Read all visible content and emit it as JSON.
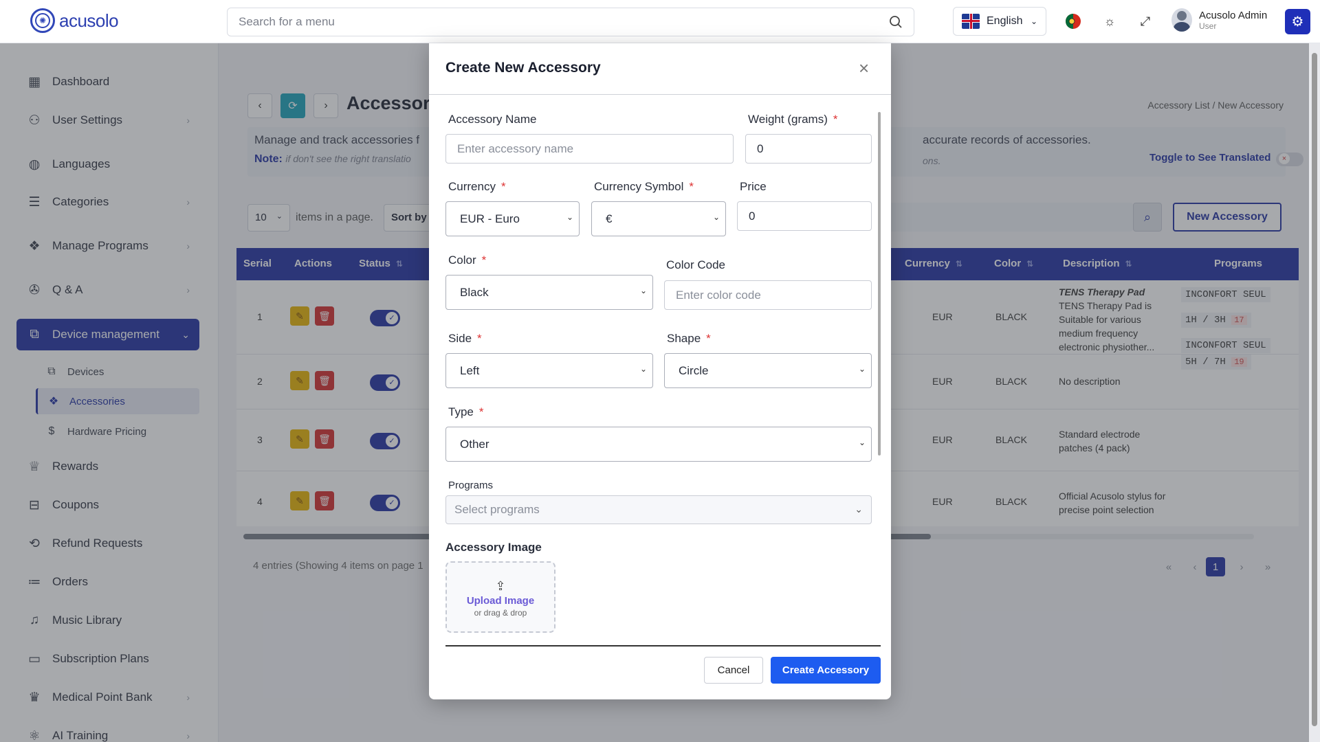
{
  "app": {
    "logo_text": "acusolo",
    "search_placeholder": "Search for a menu",
    "language": "English",
    "user_name": "Acusolo Admin",
    "user_role": "User"
  },
  "sidebar": {
    "items": [
      {
        "label": "Dashboard",
        "icon": "grid-icon"
      },
      {
        "label": "User Settings",
        "icon": "user-gear-icon"
      },
      {
        "label": "Languages",
        "icon": "globe-icon"
      },
      {
        "label": "Categories",
        "icon": "list-icon"
      },
      {
        "label": "Manage Programs",
        "icon": "programs-icon"
      },
      {
        "label": "Q & A",
        "icon": "help-icon"
      },
      {
        "label": "Device management",
        "icon": "devices-icon"
      },
      {
        "label": "Rewards",
        "icon": "trophy-icon"
      },
      {
        "label": "Coupons",
        "icon": "ticket-icon"
      },
      {
        "label": "Refund Requests",
        "icon": "refund-icon"
      },
      {
        "label": "Orders",
        "icon": "orders-icon"
      },
      {
        "label": "Music Library",
        "icon": "music-icon"
      },
      {
        "label": "Subscription Plans",
        "icon": "card-icon"
      },
      {
        "label": "Medical Point Bank",
        "icon": "medal-icon"
      },
      {
        "label": "AI Training",
        "icon": "ai-icon"
      }
    ],
    "sub_items": [
      {
        "label": "Devices"
      },
      {
        "label": "Accessories"
      },
      {
        "label": "Hardware Pricing"
      }
    ]
  },
  "page": {
    "title": "Accessory",
    "breadcrumb": "Accessory List  /  New Accessory",
    "info_line1_left": "Manage and track accessories f",
    "info_line1_right": "accurate records of accessories.",
    "note_label": "Note:",
    "note_text": "if don't see the right translatio",
    "note_text_right": "ons.",
    "toggle_translate": "Toggle to See Translated",
    "per_page": "10",
    "per_page_label": "items in a page.",
    "sort_by": "Sort by",
    "new_button": "New Accessory",
    "entries_text": "4 entries (Showing 4 items on page 1",
    "current_page": "1"
  },
  "table": {
    "headers": {
      "serial": "Serial",
      "actions": "Actions",
      "status": "Status",
      "currency": "Currency",
      "color": "Color",
      "description": "Description",
      "programs": "Programs"
    },
    "rows": [
      {
        "serial": "1",
        "currency": "EUR",
        "color": "BLACK",
        "desc_title": "TENS Therapy Pad",
        "desc": "TENS Therapy Pad is Suitable for various medium frequency electronic physiother...",
        "programs": [
          "INCONFORT SEUL",
          "1H / 3H",
          "INCONFORT SEUL"
        ],
        "prog_num": "17"
      },
      {
        "serial": "2",
        "currency": "EUR",
        "color": "BLACK",
        "desc": "No description",
        "programs": [
          "5H / 7H"
        ],
        "prog_num": "19"
      },
      {
        "serial": "3",
        "currency": "EUR",
        "color": "BLACK",
        "desc": "Standard electrode patches (4 pack)"
      },
      {
        "serial": "4",
        "currency": "EUR",
        "color": "BLACK",
        "desc": "Official Acusolo stylus for precise point selection"
      }
    ]
  },
  "modal": {
    "title": "Create New Accessory",
    "accessory_name_label": "Accessory Name",
    "accessory_name_placeholder": "Enter accessory name",
    "weight_label": "Weight (grams)",
    "weight_value": "0",
    "currency_label": "Currency",
    "currency_value": "EUR - Euro",
    "currency_symbol_label": "Currency Symbol",
    "currency_symbol_value": "€",
    "price_label": "Price",
    "price_value": "0",
    "color_label": "Color",
    "color_value": "Black",
    "color_code_label": "Color Code",
    "color_code_placeholder": "Enter color code",
    "side_label": "Side",
    "side_value": "Left",
    "shape_label": "Shape",
    "shape_value": "Circle",
    "type_label": "Type",
    "type_value": "Other",
    "programs_label": "Programs",
    "programs_placeholder": "Select programs",
    "image_label": "Accessory Image",
    "upload_label": "Upload Image",
    "upload_sub": "or drag & drop",
    "required_mark": "*",
    "cancel": "Cancel",
    "create": "Create Accessory"
  },
  "colors": {
    "primary": "#1f2fa0",
    "create_button": "#1d5cf0",
    "required": "#dd3333"
  }
}
